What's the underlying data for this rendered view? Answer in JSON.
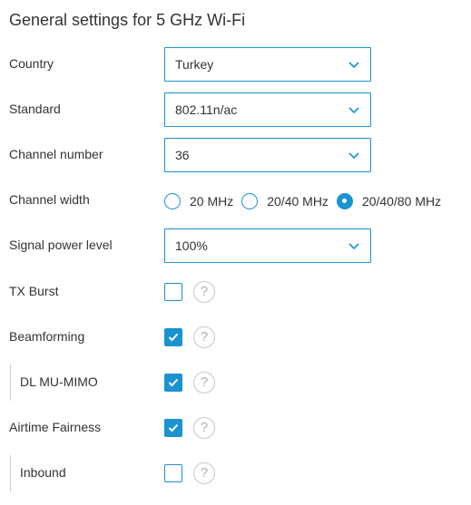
{
  "title": "General settings for 5 GHz Wi-Fi",
  "country": {
    "label": "Country",
    "value": "Turkey"
  },
  "standard": {
    "label": "Standard",
    "value": "802.11n/ac"
  },
  "channel_number": {
    "label": "Channel number",
    "value": "36"
  },
  "channel_width": {
    "label": "Channel width",
    "options": [
      "20 MHz",
      "20/40 MHz",
      "20/40/80 MHz"
    ],
    "selected": "20/40/80 MHz"
  },
  "signal_power": {
    "label": "Signal power level",
    "value": "100%"
  },
  "tx_burst": {
    "label": "TX Burst",
    "checked": false,
    "help": "?"
  },
  "beamforming": {
    "label": "Beamforming",
    "checked": true,
    "help": "?"
  },
  "dl_mu_mimo": {
    "label": "DL MU-MIMO",
    "checked": true,
    "help": "?"
  },
  "airtime_fairness": {
    "label": "Airtime Fairness",
    "checked": true,
    "help": "?"
  },
  "inbound": {
    "label": "Inbound",
    "checked": false,
    "help": "?"
  },
  "colors": {
    "accent": "#1b93d1",
    "text": "#333333",
    "help_border": "#c8c8c8"
  },
  "icons": {
    "dropdown": "chevron-down-icon",
    "check": "checkmark-icon",
    "help": "help-icon"
  }
}
